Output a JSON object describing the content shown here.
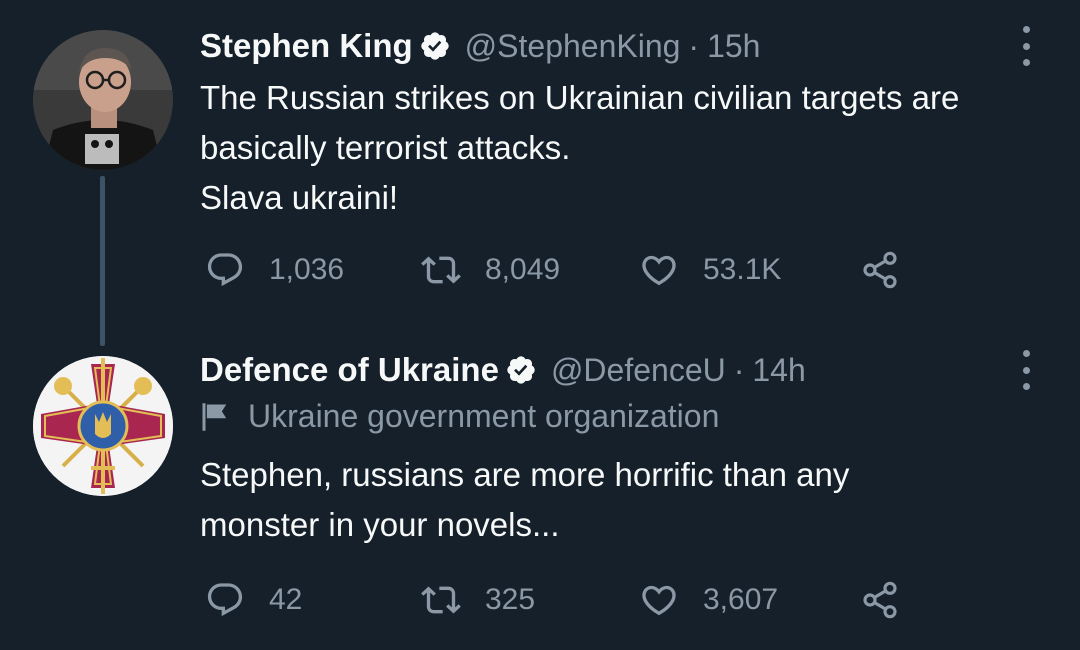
{
  "tweets": [
    {
      "display_name": "Stephen King",
      "handle": "@StephenKing",
      "separator": "·",
      "time": "15h",
      "text_lines": [
        "The Russian strikes on Ukrainian civilian targets are",
        "basically terrorist attacks.",
        "Slava ukraini!"
      ],
      "replies": "1,036",
      "retweets": "8,049",
      "likes": "53.1K"
    },
    {
      "display_name": "Defence of Ukraine",
      "handle": "@DefenceU",
      "separator": "·",
      "time": "14h",
      "label": "Ukraine government organization",
      "text_lines": [
        "Stephen, russians are more horrific than any",
        "monster in your novels..."
      ],
      "replies": "42",
      "retweets": "325",
      "likes": "3,607"
    }
  ],
  "colors": {
    "background": "#15202b",
    "text_primary": "#f7f9f9",
    "text_secondary": "#8b98a5",
    "verified_badge": "#f7f9f9",
    "thread_line": "#3d5466"
  },
  "icons": [
    "verified-badge-icon",
    "more-icon",
    "reply-icon",
    "retweet-icon",
    "like-icon",
    "share-icon",
    "government-flag-icon"
  ]
}
